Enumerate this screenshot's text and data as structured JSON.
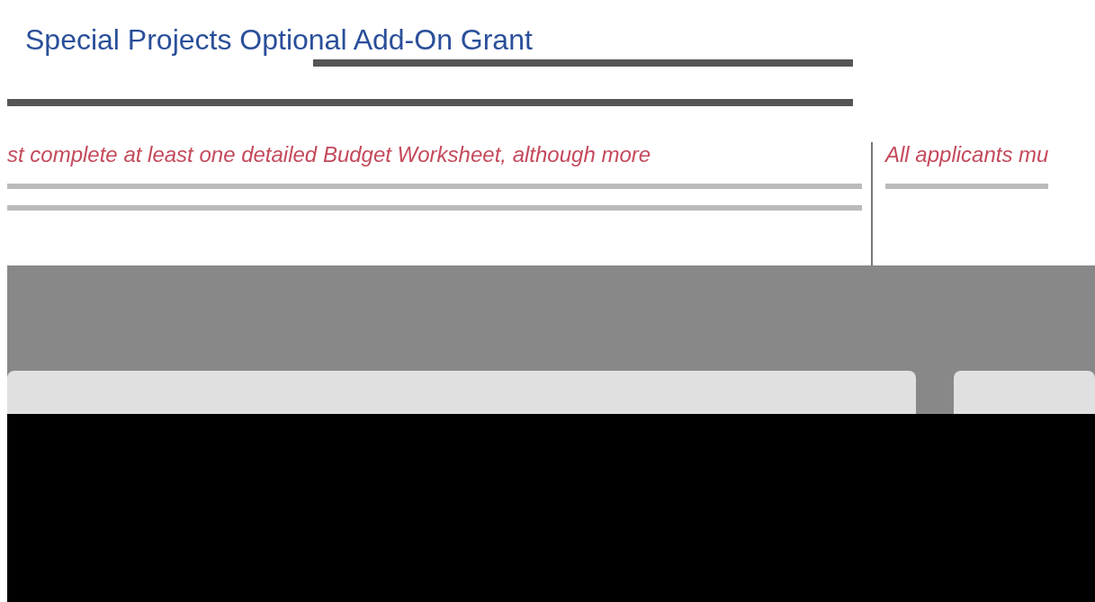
{
  "title": "Special Projects Optional Add-On Grant",
  "columns": [
    {
      "note": "st complete at least one detailed Budget Worksheet, although more"
    },
    {
      "note": "All applicants mu"
    }
  ]
}
